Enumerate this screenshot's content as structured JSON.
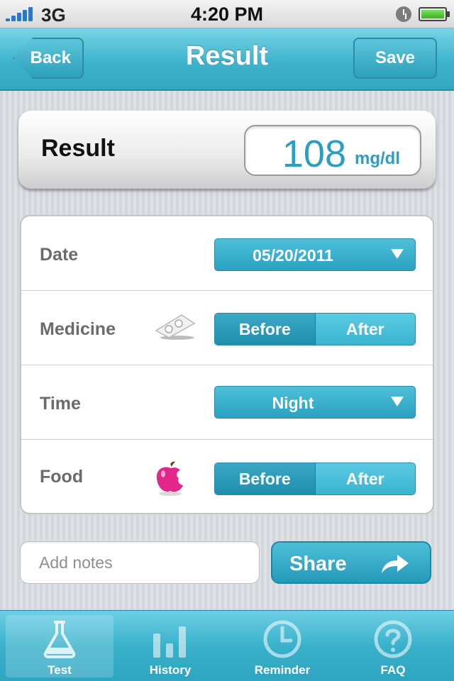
{
  "status_bar": {
    "carrier": "3G",
    "time": "4:20 PM",
    "signal_bars": 5,
    "battery_level": 1.0
  },
  "nav": {
    "back_label": "Back",
    "title": "Result",
    "save_label": "Save"
  },
  "result": {
    "label": "Result",
    "value": "108",
    "unit": "mg/dl"
  },
  "form": {
    "date": {
      "label": "Date",
      "value": "05/20/2011"
    },
    "medicine": {
      "label": "Medicine",
      "icon": "pill-pack-icon",
      "options": [
        "Before",
        "After"
      ],
      "selected": "Before"
    },
    "time": {
      "label": "Time",
      "value": "Night"
    },
    "food": {
      "label": "Food",
      "icon": "apple-icon",
      "options": [
        "Before",
        "After"
      ],
      "selected": "Before"
    }
  },
  "notes": {
    "placeholder": "Add notes",
    "value": ""
  },
  "share": {
    "label": "Share"
  },
  "tabs": [
    {
      "label": "Test",
      "icon": "flask-icon",
      "active": true
    },
    {
      "label": "History",
      "icon": "bar-chart-icon",
      "active": false
    },
    {
      "label": "Reminder",
      "icon": "clock-icon",
      "active": false
    },
    {
      "label": "FAQ",
      "icon": "question-icon",
      "active": false
    }
  ],
  "colors": {
    "accent": "#3fb3cc",
    "value_text": "#2a9fc2",
    "label_gray": "#6b6b6b"
  }
}
